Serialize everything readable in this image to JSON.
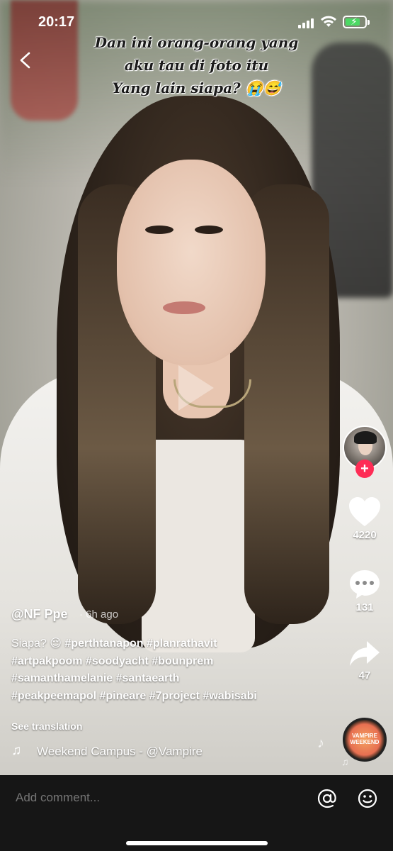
{
  "status_bar": {
    "time": "20:17"
  },
  "video": {
    "overlay_text": [
      "Dan ini orang-orang yang",
      "aku tau di foto itu",
      "Yang lain siapa? 😭😅"
    ]
  },
  "actions": {
    "likes": "4220",
    "comments": "131",
    "shares": "47"
  },
  "post": {
    "username": "@NF Ppe",
    "age": "· 6h ago",
    "caption_lines": [
      {
        "text": "Siapa? 😌 ",
        "tags": "#perthtanapon #planrathavit"
      },
      {
        "text": "",
        "tags": "#artpakpoom #soodyacht #bounprem"
      },
      {
        "text": "",
        "tags": "#samanthamelanie #santaearth"
      },
      {
        "text": "",
        "tags": "#peakpeemapol #pineare #7project #wabisabi"
      }
    ],
    "see_translation": "See translation",
    "sound": "Weekend     Campus - @Vampire Weekend",
    "disc_label": "VAMPIRE WEEKEND"
  },
  "comment_bar": {
    "placeholder": "Add comment..."
  },
  "colors": {
    "follow_badge": "#fe2c55",
    "battery_fill": "#4cd964",
    "comment_bar_bg": "#161616"
  },
  "icons": [
    "back-icon",
    "signal-icon",
    "wifi-icon",
    "battery-icon",
    "play-icon",
    "heart-icon",
    "comment-icon",
    "share-icon",
    "music-note-icon",
    "mention-icon",
    "emoji-icon"
  ]
}
